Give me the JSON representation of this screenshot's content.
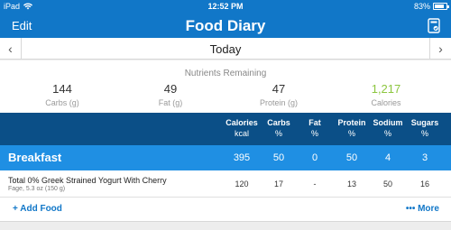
{
  "status_bar": {
    "device": "iPad",
    "time": "12:52 PM",
    "battery_percent": "83%",
    "battery_level": 0.83
  },
  "nav": {
    "edit_label": "Edit",
    "title": "Food Diary",
    "right_icon": "diary-share-icon"
  },
  "date_bar": {
    "date": "Today",
    "prev_icon": "chevron-left-icon",
    "next_icon": "chevron-right-icon"
  },
  "nutrients": {
    "heading": "Nutrients Remaining",
    "items": [
      {
        "value": "144",
        "label": "Carbs (g)"
      },
      {
        "value": "49",
        "label": "Fat (g)"
      },
      {
        "value": "47",
        "label": "Protein (g)"
      },
      {
        "value": "1,217",
        "label": "Calories",
        "color": "#8cc63f"
      }
    ]
  },
  "columns": [
    {
      "name": "Calories",
      "unit": "kcal"
    },
    {
      "name": "Carbs",
      "unit": "%"
    },
    {
      "name": "Fat",
      "unit": "%"
    },
    {
      "name": "Protein",
      "unit": "%"
    },
    {
      "name": "Sodium",
      "unit": "%"
    },
    {
      "name": "Sugars",
      "unit": "%"
    }
  ],
  "meal": {
    "name": "Breakfast",
    "values": [
      "395",
      "50",
      "0",
      "50",
      "4",
      "3"
    ]
  },
  "foods": [
    {
      "name": "Total 0% Greek Strained Yogurt With Cherry",
      "description": "Fage, 5.3 oz (150 g)",
      "values": [
        "120",
        "17",
        "-",
        "13",
        "50",
        "16"
      ]
    }
  ],
  "footer": {
    "add_label": "+ Add Food",
    "more_label": "••• More"
  },
  "colors": {
    "nav_blue": "#1177c8",
    "header_dark": "#0b4f87",
    "meal_blue": "#1f8fe3",
    "calories_green": "#8cc63f"
  }
}
